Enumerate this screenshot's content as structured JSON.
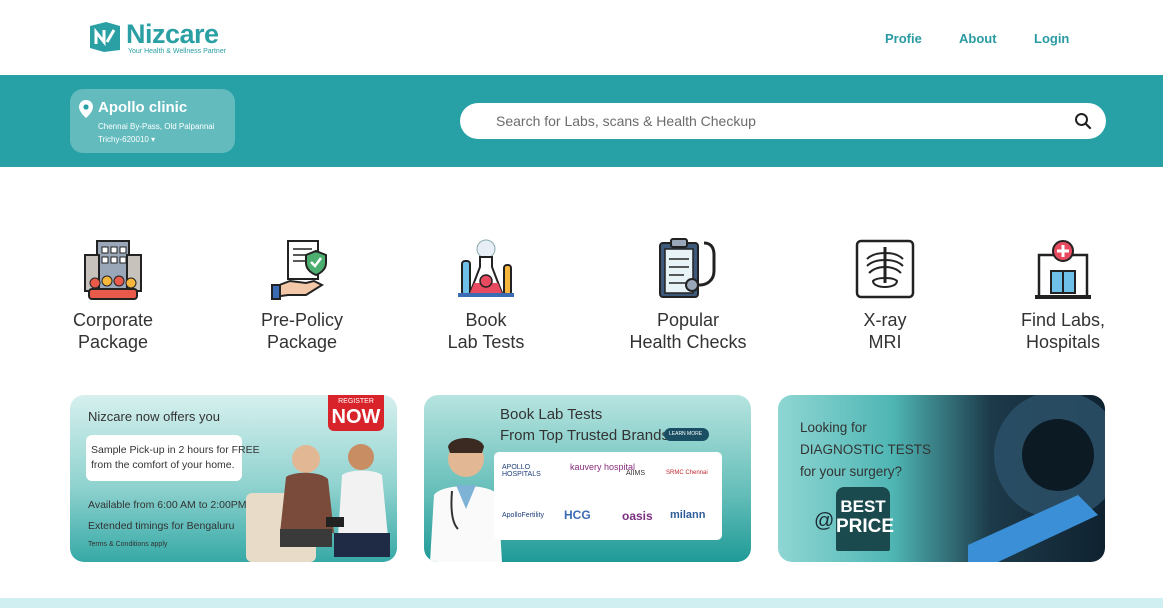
{
  "brand": {
    "name": "Nizcare",
    "tagline": "Your Health & Wellness Partner",
    "color": "#2aa0a4"
  },
  "nav": {
    "profile": "Profie",
    "about": "About",
    "login": "Login"
  },
  "location": {
    "name": "Apollo clinic",
    "address_line1": "Chennai By-Pass, Old Palpannai",
    "address_line2": "Trichy-620010 ▾"
  },
  "search": {
    "placeholder": "Search for Labs, scans & Health Checkup"
  },
  "categories": [
    {
      "line1": "Corporate",
      "line2": "Package",
      "icon": "office-building-icon"
    },
    {
      "line1": "Pre-Policy",
      "line2": "Package",
      "icon": "policy-hand-icon"
    },
    {
      "line1": "Book",
      "line2": "Lab Tests",
      "icon": "lab-flask-icon"
    },
    {
      "line1": "Popular",
      "line2": "Health Checks",
      "icon": "clipboard-stethoscope-icon"
    },
    {
      "line1": "X-ray",
      "line2": "MRI",
      "icon": "xray-chest-icon"
    },
    {
      "line1": "Find Labs,",
      "line2": "Hospitals",
      "icon": "hospital-icon"
    }
  ],
  "banner1": {
    "intro": "Nizcare now offers you",
    "badge_top": "REGISTER",
    "badge_main": "NOW",
    "box_line1": "Sample Pick-up in 2 hours for FREE",
    "box_line2": "from the comfort of your home.",
    "hours": "Available from 6:00 AM to 2:00PM",
    "extended": "Extended timings for Bengaluru",
    "terms": "Terms & Conditions apply"
  },
  "banner2": {
    "title1": "Book Lab Tests",
    "title2": "From Top Trusted Brands",
    "learn_more": "LEARN MORE",
    "brands": [
      "APOLLO HOSPITALS",
      "kauvery hospital",
      "AIIMS",
      "SRMC Chennai",
      "ApolloFertility",
      "HCG",
      "oasis",
      "milann"
    ]
  },
  "banner3": {
    "line1": "Looking for",
    "line2": "DIAGNOSTIC TESTS",
    "line3": "for your surgery?",
    "at": "@",
    "best": "BEST",
    "price": "PRICE"
  }
}
